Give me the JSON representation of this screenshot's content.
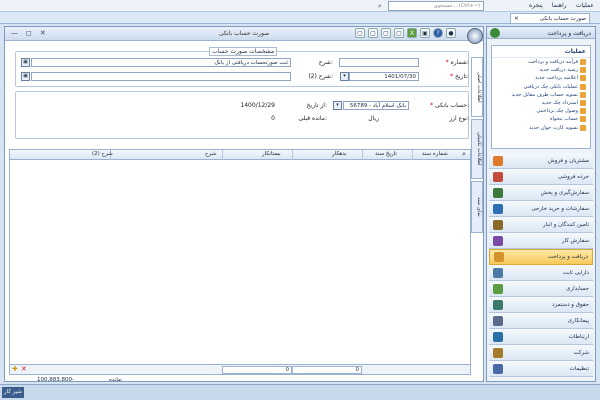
{
  "menu": {
    "items": [
      "عملیات",
      "راهنما",
      "پنجره"
    ]
  },
  "search": {
    "placeholder": "جستجوی... (Ctrl+~)"
  },
  "tab": {
    "label": "صورت حساب بانکی"
  },
  "window": {
    "title": "صورت حساب بانکی",
    "controls": [
      "—",
      "◻",
      "✕"
    ],
    "toolbar": [
      "▢",
      "▢",
      "▢",
      "▢",
      "X",
      "▣",
      "?",
      "●"
    ]
  },
  "form": {
    "group_title": "مشخصات صورت حساب",
    "number_label": "شماره:",
    "number_value": "",
    "date_label": "تاریخ:",
    "date_value": "1401/07/30",
    "desc_label": "شرح:",
    "desc_value": "ثبت صورتحساب دریافتی از بانک",
    "desc2_label": "شرح (2):",
    "desc2_value": "",
    "bank_account_label": "حساب بانکی:",
    "bank_account_value": "56789 - بانک اسلام آباد",
    "to_date_label": "از تاریخ:",
    "to_date_value": "1400/12/29",
    "currency_label": "نوع ارز:",
    "currency_value": "ریال",
    "balance_label": "مانده قبلی:",
    "balance_value": "0"
  },
  "sidetabs": [
    "اطلاعات اصلی",
    "اطلاعات تکمیلی",
    "نمای سند"
  ],
  "grid": {
    "columns": [
      "شماره سند",
      "تاریخ سند",
      "بدهکار",
      "بستانکار",
      "شرح",
      "شرح (2)"
    ],
    "totals": {
      "debit": "0",
      "credit": "0"
    }
  },
  "doc_status": {
    "balance_label": "مانده:",
    "balance_value": "100,883,800-"
  },
  "nav": {
    "header": "دریافت و پرداخت",
    "ops_title": "عملیات",
    "operations": [
      "فرآیند دریافت و پرداخت",
      "رسید دریافت جدید",
      "اعلامیه پرداخت جدید",
      "عملیات بانکی چک دریافتی",
      "تسویه حساب طرف مقابل جدید",
      "استرداد چک جدید",
      "وصول چک پرداختنی",
      "حساب تنخواه",
      "تسویه کارت خوان جدید"
    ],
    "modules": [
      {
        "label": "مشتریان و فروش",
        "color": "#e07a2a"
      },
      {
        "label": "خرده فروشی",
        "color": "#c44a3a"
      },
      {
        "label": "سفارش‌گیری و پخش",
        "color": "#3c7a3c"
      },
      {
        "label": "سفارشات و خرید خارجی",
        "color": "#2e6fb5"
      },
      {
        "label": "تامین کنندگان و انبار",
        "color": "#8a6a2a"
      },
      {
        "label": "سفارش کار",
        "color": "#7a4aa5"
      },
      {
        "label": "دریافت و پرداخت",
        "color": "#d4932a"
      },
      {
        "label": "دارایی ثابت",
        "color": "#4a7aa5"
      },
      {
        "label": "حسابداری",
        "color": "#5a9c3f"
      },
      {
        "label": "حقوق و دستمزد",
        "color": "#3a7a6a"
      },
      {
        "label": "پیمانکاری",
        "color": "#5a6a8a"
      },
      {
        "label": "ارتباطات",
        "color": "#2a6fa5"
      },
      {
        "label": "شرکت",
        "color": "#a57a2a"
      },
      {
        "label": "تنظیمات",
        "color": "#4a6aa5"
      }
    ],
    "active_module": 6
  },
  "status": {
    "button": "شیر کار"
  }
}
